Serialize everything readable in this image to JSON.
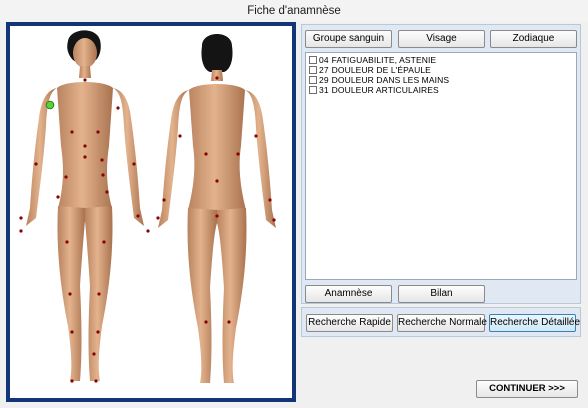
{
  "window": {
    "title": "Fiche d'anamnèse"
  },
  "colors": {
    "frame": "#12357a",
    "panel": "#dfe8f3",
    "active_button": "#cfe8f8",
    "marker_point": "#8b0000",
    "selected_point": "#5bd337"
  },
  "figures": {
    "front_icon": "female-figure-front",
    "back_icon": "female-figure-back"
  },
  "top_buttons": [
    {
      "label": "Groupe sanguin"
    },
    {
      "label": "Visage"
    },
    {
      "label": "Zodiaque"
    }
  ],
  "symptoms": [
    {
      "code": "04",
      "label": "FATIGUABILITE, ASTENIE",
      "checked": false
    },
    {
      "code": "27",
      "label": "DOULEUR DE L'ÉPAULE",
      "checked": false
    },
    {
      "code": "29",
      "label": "DOULEUR DANS LES MAINS",
      "checked": false
    },
    {
      "code": "31",
      "label": "DOULEUR ARTICULAIRES",
      "checked": false
    }
  ],
  "mid_buttons": [
    {
      "label": "Anamnèse"
    },
    {
      "label": "Bilan"
    }
  ],
  "search_buttons": [
    {
      "label": "Recherche Rapide",
      "active": false
    },
    {
      "label": "Recherche Normale",
      "active": false
    },
    {
      "label": "Recherche Détaillée",
      "active": true
    }
  ],
  "continue_button": {
    "label": "CONTINUER >>>"
  }
}
